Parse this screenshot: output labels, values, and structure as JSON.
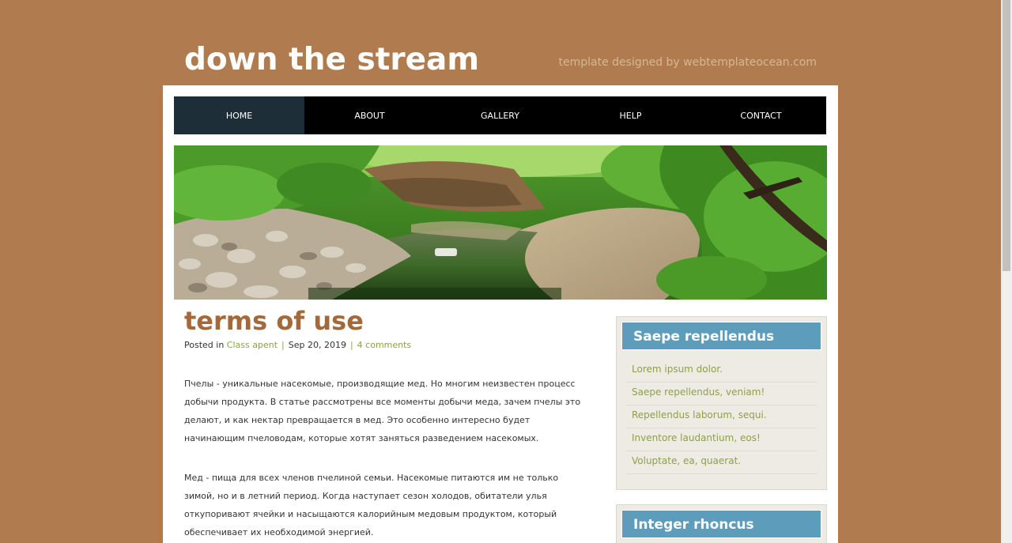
{
  "header": {
    "site_title": "down the stream",
    "credit": "template designed by webtemplateocean.com"
  },
  "nav": {
    "items": [
      "HOME",
      "ABOUT",
      "GALLERY",
      "HELP",
      "CONTACT"
    ],
    "active": "HOME"
  },
  "banner": {
    "alt": "forest stream photo"
  },
  "post": {
    "title": "terms of use",
    "meta_prefix": "Posted in",
    "category": "Class apent",
    "date": "Sep 20, 2019",
    "comments": "4 comments",
    "paragraphs": [
      "Пчелы - уникальные насекомые, производящие мед. Но многим неизвестен процесс добычи продукта. В статье рассмотрены все моменты добычи меда, зачем пчелы это делают, и как нектар превращается в мед. Это особенно интересно будет начинающим пчеловодам, которые хотят заняться разведением насекомых.",
      "Мед - пища для всех членов пчелиной семьи. Насекомые питаются им не только зимой, но и в летний период. Когда наступает сезон холодов, обитатели улья откупоривают ячейки и насыщаются калорийным медовым продуктом, который обеспечивает их необходимой энергией."
    ]
  },
  "sidebar": {
    "widget1": {
      "title": "Saepe repellendus",
      "items": [
        "Lorem ipsum dolor.",
        "Saepe repellendus, veniam!",
        "Repellendus laborum, sequi.",
        "Inventore laudantium, eos!",
        "Voluptate, ea, quaerat."
      ]
    },
    "widget2": {
      "title": "Integer rhoncus"
    }
  },
  "colors": {
    "background": "#b07b4e",
    "nav_bg": "#000000",
    "nav_active": "#1e2e38",
    "title": "#a4693b",
    "link": "#8fa04a",
    "widget_header": "#5e9cbc",
    "widget_bg": "#edebe3"
  }
}
